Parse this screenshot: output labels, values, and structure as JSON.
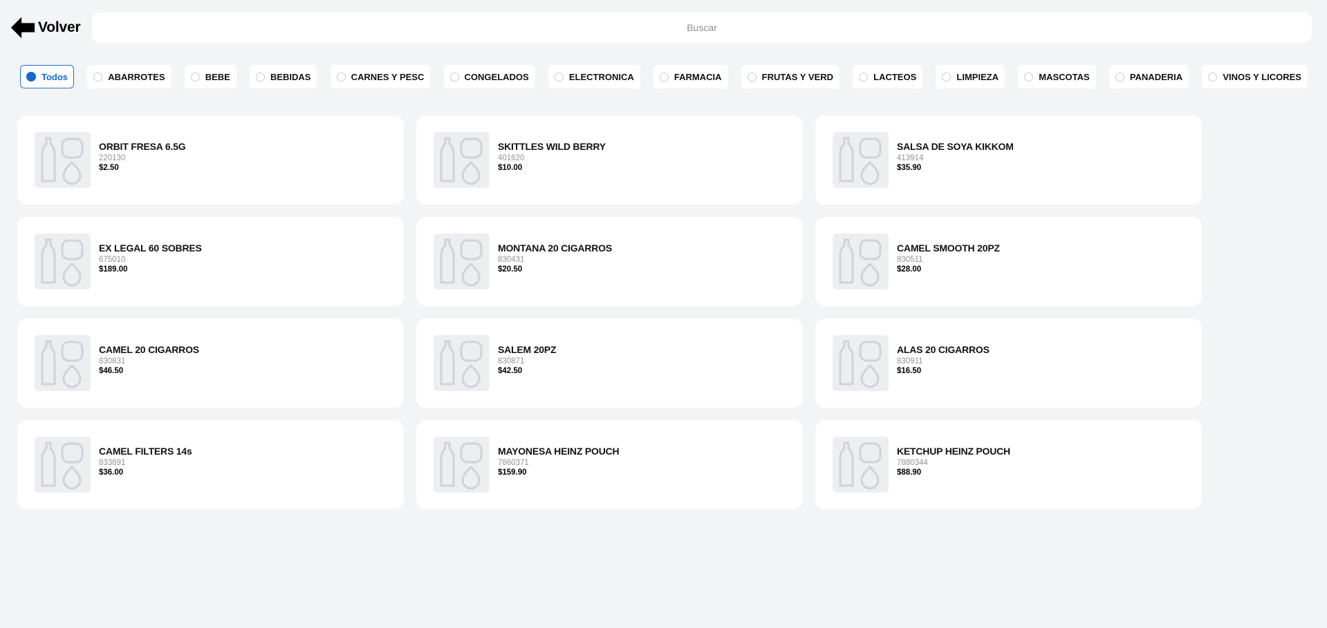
{
  "header": {
    "back_label": "Volver",
    "search_placeholder": "Buscar"
  },
  "categories": [
    {
      "label": "Todos",
      "selected": true
    },
    {
      "label": "ABARROTES",
      "selected": false
    },
    {
      "label": "BEBE",
      "selected": false
    },
    {
      "label": "BEBIDAS",
      "selected": false
    },
    {
      "label": "CARNES Y PESC",
      "selected": false
    },
    {
      "label": "CONGELADOS",
      "selected": false
    },
    {
      "label": "ELECTRONICA",
      "selected": false
    },
    {
      "label": "FARMACIA",
      "selected": false
    },
    {
      "label": "FRUTAS Y VERD",
      "selected": false
    },
    {
      "label": "LACTEOS",
      "selected": false
    },
    {
      "label": "LIMPIEZA",
      "selected": false
    },
    {
      "label": "MASCOTAS",
      "selected": false
    },
    {
      "label": "PANADERIA",
      "selected": false
    },
    {
      "label": "VINOS Y LICORES",
      "selected": false
    }
  ],
  "products": [
    {
      "name": "ORBIT FRESA 6.5G",
      "code": "220130",
      "price": "$2.50"
    },
    {
      "name": "SKITTLES WILD BERRY",
      "code": "401620",
      "price": "$10.00"
    },
    {
      "name": "SALSA DE SOYA KIKKOM",
      "code": "413914",
      "price": "$35.90"
    },
    {
      "name": "EX LEGAL 60 SOBRES",
      "code": "675010",
      "price": "$189.00"
    },
    {
      "name": "MONTANA 20 CIGARROS",
      "code": "830431",
      "price": "$20.50"
    },
    {
      "name": "CAMEL SMOOTH 20PZ",
      "code": "830511",
      "price": "$28.00"
    },
    {
      "name": "CAMEL 20 CIGARROS",
      "code": "830831",
      "price": "$46.50"
    },
    {
      "name": "SALEM 20PZ",
      "code": "830871",
      "price": "$42.50"
    },
    {
      "name": "ALAS 20 CIGARROS",
      "code": "830911",
      "price": "$16.50"
    },
    {
      "name": "CAMEL FILTERS 14s",
      "code": "833891",
      "price": "$36.00"
    },
    {
      "name": "MAYONESA HEINZ POUCH",
      "code": "7860371",
      "price": "$159.90"
    },
    {
      "name": "KETCHUP HEINZ POUCH",
      "code": "7880344",
      "price": "$88.90"
    }
  ],
  "colors": {
    "accent": "#1467d6",
    "background": "#f3f4f6",
    "card": "#ffffff"
  }
}
